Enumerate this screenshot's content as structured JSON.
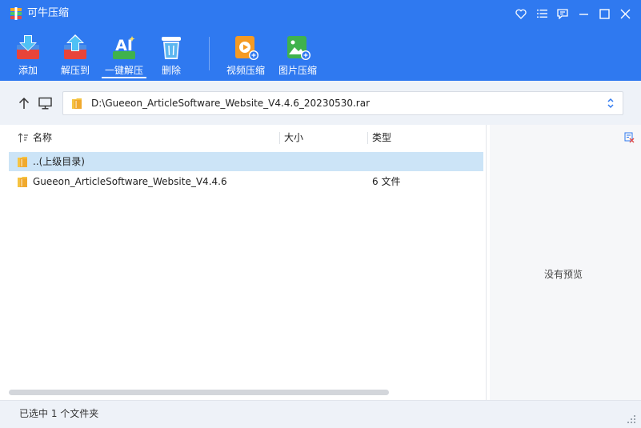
{
  "window": {
    "title": "可牛压缩",
    "controls": [
      "heart-icon",
      "menu-icon",
      "chat-icon",
      "minimize-icon",
      "maximize-icon",
      "close-icon"
    ]
  },
  "toolbar": {
    "add_label": "添加",
    "extract_to_label": "解压到",
    "one_click_extract_label": "一键解压",
    "delete_label": "删除",
    "video_compress_label": "视频压缩",
    "image_compress_label": "图片压缩",
    "active_tool": "一键解压"
  },
  "address": {
    "path": "D:\\Gueeon_ArticleSoftware_Website_V4.4.6_20230530.rar"
  },
  "list": {
    "columns": {
      "name": "名称",
      "size": "大小",
      "type": "类型"
    },
    "rows": [
      {
        "name": "..(上级目录)",
        "size": "",
        "type": "",
        "selected": true
      },
      {
        "name": "Gueeon_ArticleSoftware_Website_V4.4.6",
        "size": "",
        "type": "6 文件",
        "selected": false
      }
    ]
  },
  "preview": {
    "empty_text": "没有预览"
  },
  "status": {
    "text": "已选中 1 个文件夹"
  },
  "colors": {
    "header_blue": "#2f79f0",
    "selection": "#cce4f7",
    "folder_yellow": "#f5c342"
  }
}
